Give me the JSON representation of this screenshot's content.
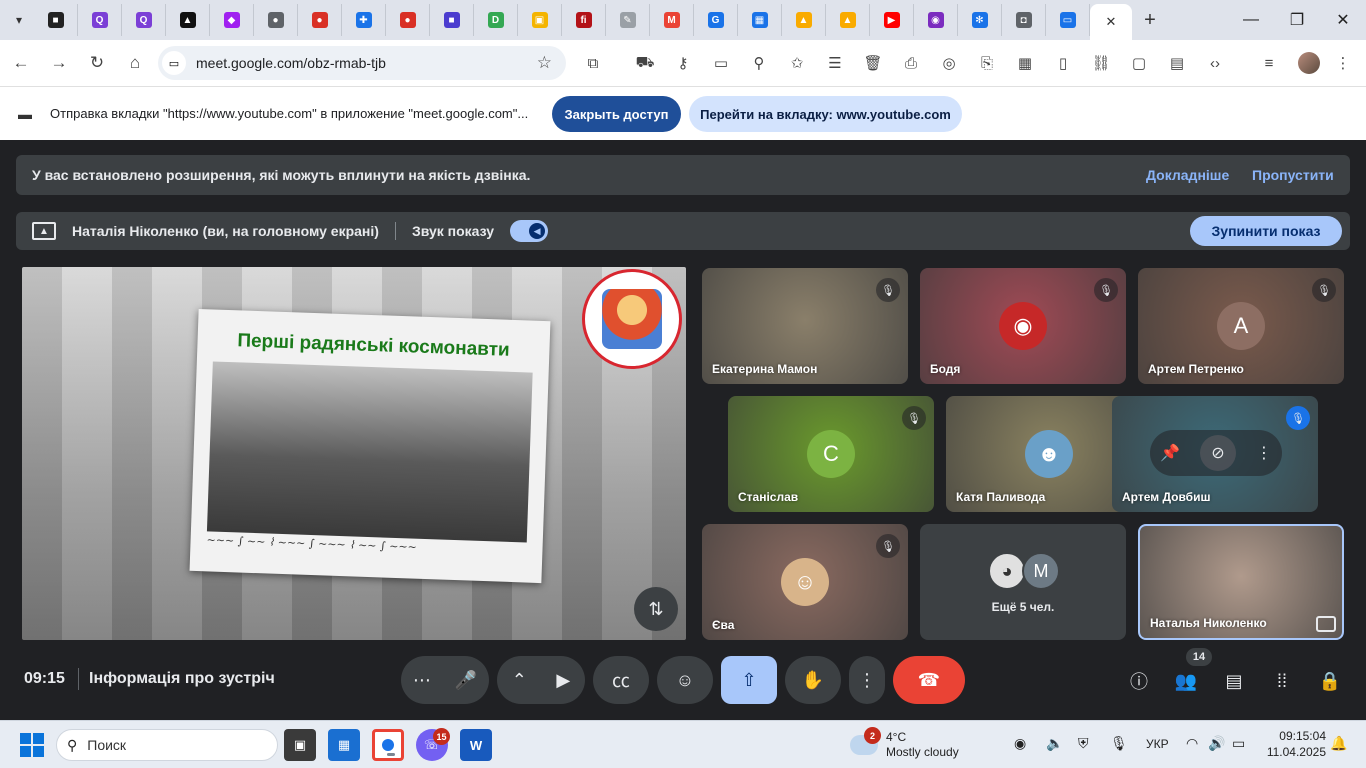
{
  "browser": {
    "tabs": [
      {
        "icon": "chrome-menu-icon",
        "color": "#202124",
        "glyph": "▾"
      },
      {
        "icon": "bandcamp-icon",
        "color": "#222222",
        "glyph": "■"
      },
      {
        "icon": "q-icon",
        "color": "#7b3fd6",
        "glyph": "Q"
      },
      {
        "icon": "q-icon-2",
        "color": "#7b3fd6",
        "glyph": "Q"
      },
      {
        "icon": "triangle-icon",
        "color": "#111111",
        "glyph": "▲"
      },
      {
        "icon": "hex-icon",
        "color": "#a020f0",
        "glyph": "◆"
      },
      {
        "icon": "globe-icon",
        "color": "#5f6368",
        "glyph": "●"
      },
      {
        "icon": "red-ball-icon",
        "color": "#d93025",
        "glyph": "●"
      },
      {
        "icon": "puzzle-icon",
        "color": "#1a73e8",
        "glyph": "✚"
      },
      {
        "icon": "red-ball-icon-2",
        "color": "#d93025",
        "glyph": "●"
      },
      {
        "icon": "blue-square-icon",
        "color": "#4b3ccf",
        "glyph": "■"
      },
      {
        "icon": "d-icon",
        "color": "#34a853",
        "glyph": "D"
      },
      {
        "icon": "id-card-icon",
        "color": "#f4b400",
        "glyph": "▣"
      },
      {
        "icon": "fi-icon",
        "color": "#b31217",
        "glyph": "fi"
      },
      {
        "icon": "pencil-icon",
        "color": "#9aa0a6",
        "glyph": "✎"
      },
      {
        "icon": "gmail-icon",
        "color": "#ea4335",
        "glyph": "M"
      },
      {
        "icon": "g-icon",
        "color": "#1a73e8",
        "glyph": "G"
      },
      {
        "icon": "grid-icon",
        "color": "#1a73e8",
        "glyph": "▦"
      },
      {
        "icon": "bell-icon",
        "color": "#f9ab00",
        "glyph": "▲"
      },
      {
        "icon": "bell-icon-2",
        "color": "#f9ab00",
        "glyph": "▲"
      },
      {
        "icon": "youtube-icon",
        "color": "#ff0000",
        "glyph": "▶"
      },
      {
        "icon": "badge-icon",
        "color": "#7b2cbf",
        "glyph": "◉"
      },
      {
        "icon": "snowflake-icon",
        "color": "#1a73e8",
        "glyph": "✻"
      },
      {
        "icon": "shield-icon",
        "color": "#5f6368",
        "glyph": "◘"
      },
      {
        "icon": "meet-icon",
        "color": "#1a73e8",
        "glyph": "▭"
      }
    ],
    "new_tab": "+",
    "url": "meet.google.com/obz-rmab-tjb",
    "minimize": "—",
    "maximize": "❐",
    "close": "✕"
  },
  "infobar": {
    "text": "Отправка вкладки \"https://www.youtube.com\" в приложение \"meet.google.com\"...",
    "stop_label": "Закрыть доступ",
    "switch_label": "Перейти на вкладку: www.youtube.com"
  },
  "meet": {
    "banner_text": "У вас встановлено розширення, які можуть вплинути на якість дзвінка.",
    "banner_more": "Докладніше",
    "banner_skip": "Пропустити",
    "presenter": "Наталія Ніколенко (ви, на головному екрані)",
    "sound_label": "Звук показу",
    "stop_share": "Зупинити показ",
    "slide_title": "Перші радянські космонавти",
    "tiles": [
      {
        "name": "Екатерина Мамон",
        "bg": "#8a7f6a",
        "muted": true
      },
      {
        "name": "Бодя",
        "bg": "#a04a55",
        "muted": true,
        "avatar": "spider-icon"
      },
      {
        "name": "Артем Петренко",
        "bg": "#7a5a4c",
        "muted": true,
        "letter": "А",
        "letter_bg": "#8d6e63"
      },
      {
        "name": "Станіслав",
        "bg": "#6a9a2c",
        "muted": true,
        "letter": "С",
        "letter_bg": "#7cb342"
      },
      {
        "name": "Катя Паливода",
        "bg": "#8a8260",
        "muted": true
      },
      {
        "name": "Артем Довбиш",
        "bg": "#3d6a78",
        "muted": true
      },
      {
        "name": "Єва",
        "bg": "#8a6a60",
        "muted": true
      },
      {
        "name": "Наталья Николенко",
        "bg": "#b09a8c",
        "muted": false
      }
    ],
    "more_people": "Ещё 5 чел.",
    "more_letter": "M",
    "time": "09:15",
    "meeting_info": "Інформація про зустріч",
    "participants_count": "14"
  },
  "taskbar": {
    "search_placeholder": "Поиск",
    "viber_badge": "15",
    "weather_badge": "2",
    "weather_temp": "4°C",
    "weather_desc": "Mostly cloudy",
    "lang": "УКР",
    "clock_time": "09:15:04",
    "clock_date": "11.04.2025"
  }
}
